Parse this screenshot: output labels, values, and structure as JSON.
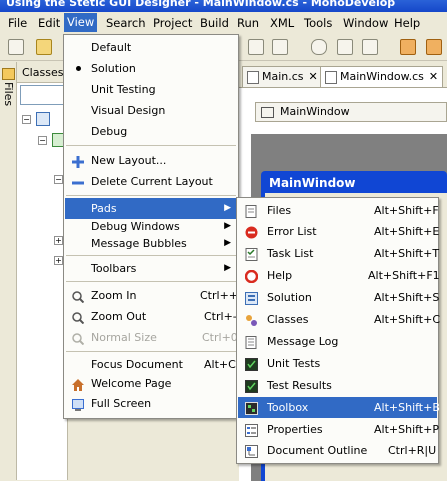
{
  "window": {
    "title": "Using the Stetic GUI Designer - MainWindow.cs - MonoDevelop"
  },
  "menubar": [
    "File",
    "Edit",
    "View",
    "Search",
    "Project",
    "Build",
    "Run",
    "XML",
    "Tools",
    "Window",
    "Help"
  ],
  "left_pads": {
    "files_label": "Files",
    "classes_label": "Classes"
  },
  "document": {
    "tabs": [
      {
        "label": "Main.cs",
        "close": "✕"
      },
      {
        "label": "MainWindow.cs",
        "close": "✕"
      }
    ],
    "widget_button": "MainWindow",
    "window_title": "MainWindow"
  },
  "view_menu": [
    {
      "label": "Default"
    },
    {
      "label": "Solution",
      "checked": true
    },
    {
      "label": "Unit Testing"
    },
    {
      "label": "Visual Design"
    },
    {
      "label": "Debug"
    },
    {
      "label": "New Layout...",
      "icon": "plus-icon"
    },
    {
      "label": "Delete Current Layout",
      "icon": "minus-icon"
    },
    {
      "label": "Pads",
      "submenu": true,
      "highlighted": true
    },
    {
      "label": "Debug Windows",
      "submenu": true
    },
    {
      "label": "Message Bubbles",
      "submenu": true
    },
    {
      "label": "Toolbars",
      "submenu": true
    },
    {
      "label": "Zoom In",
      "shortcut": "Ctrl++",
      "icon": "zoom-in-icon"
    },
    {
      "label": "Zoom Out",
      "shortcut": "Ctrl+-",
      "icon": "zoom-out-icon"
    },
    {
      "label": "Normal Size",
      "shortcut": "Ctrl+0",
      "icon": "zoom-normal-icon",
      "disabled": true
    },
    {
      "label": "Focus Document",
      "shortcut": "Alt+C"
    },
    {
      "label": "Welcome Page",
      "icon": "home-icon"
    },
    {
      "label": "Full Screen",
      "icon": "fullscreen-icon"
    }
  ],
  "pads_menu": [
    {
      "label": "Files",
      "shortcut": "Alt+Shift+F",
      "icon": "files-icon"
    },
    {
      "label": "Error List",
      "shortcut": "Alt+Shift+E",
      "icon": "error-icon"
    },
    {
      "label": "Task List",
      "shortcut": "Alt+Shift+T",
      "icon": "task-list-icon"
    },
    {
      "label": "Help",
      "shortcut": "Alt+Shift+F1",
      "icon": "help-icon"
    },
    {
      "label": "Solution",
      "shortcut": "Alt+Shift+S",
      "icon": "solution-icon"
    },
    {
      "label": "Classes",
      "shortcut": "Alt+Shift+C",
      "icon": "classes-icon"
    },
    {
      "label": "Message Log",
      "shortcut": "",
      "icon": "message-log-icon"
    },
    {
      "label": "Unit Tests",
      "shortcut": "",
      "icon": "unit-tests-icon"
    },
    {
      "label": "Test Results",
      "shortcut": "",
      "icon": "test-results-icon"
    },
    {
      "label": "Toolbox",
      "shortcut": "Alt+Shift+B",
      "icon": "toolbox-icon",
      "highlighted": true
    },
    {
      "label": "Properties",
      "shortcut": "Alt+Shift+P",
      "icon": "properties-icon"
    },
    {
      "label": "Document Outline",
      "shortcut": "Ctrl+R|U",
      "icon": "document-outline-icon"
    }
  ],
  "colors": {
    "highlight": "#316ac5",
    "menu_bg": "#fcfcf9",
    "chrome": "#ece9d8",
    "titlebar": "#1547c9"
  }
}
